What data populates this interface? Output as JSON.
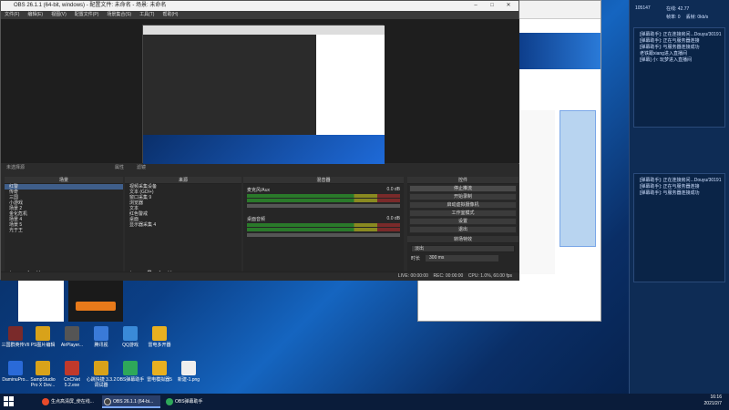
{
  "obs": {
    "title": "OBS 26.1.1 (64-bit, windows) - 配置文件: 未命名 - 场景: 未命名",
    "menu": [
      "文件(F)",
      "编辑(E)",
      "视图(V)",
      "配置文件(P)",
      "场景集合(S)",
      "工具(T)",
      "帮助(H)"
    ],
    "no_source_selected": "未选择源",
    "properties_label": "属性",
    "filters_label": "滤镜",
    "docks": {
      "scenes_title": "场景",
      "scenes": [
        "红警",
        "传奇",
        "三国",
        "小游戏",
        "场景 2",
        "金化危机",
        "场景 4",
        "场景 5",
        "光于王"
      ],
      "sources_title": "来源",
      "sources": [
        "视频采集设备",
        "文本 (GDI+)",
        "窗口采集 9",
        "浏览器",
        "文本",
        "红色警戒",
        "桌面",
        "显示器采集 4"
      ],
      "mixer_title": "混音器",
      "mixer": [
        {
          "name": "麦克风/Aux",
          "db": "0.0 dB"
        },
        {
          "name": "桌面音频",
          "db": "0.0 dB"
        }
      ],
      "controls_title": "控件",
      "controls": [
        "停止推流",
        "开始录制",
        "启动虚拟摄像机",
        "工作室模式",
        "设置",
        "退出"
      ],
      "transitions_title": "转场特效",
      "transition_type": "淡出",
      "duration_label": "时长",
      "duration_value": "300 ms"
    },
    "status": {
      "live": "LIVE: 00:00:00",
      "rec": "REC: 00:00:00",
      "cpu": "CPU: 1.0%, 60.00 fps"
    }
  },
  "rpanel": {
    "stats": [
      "在线: 42.77",
      "帧率: 0",
      "丢帧: 0kb/s"
    ],
    "user_id": "105147",
    "messages": [
      "[弹幕助手]: 正在连接房间...Douyu/30191",
      "[弹幕助手]: 正在与服务器连接",
      "[弹幕助手]: 与服务器连接成功",
      "老铁跟xiang进入直播间",
      "[弹幕] 小: 玩梦进入直播间"
    ],
    "messages2": [
      "[弹幕助手]: 正在连接房间...Douyu/30191",
      "[弹幕助手]: 正在与服务器连接",
      "[弹幕助手]: 与服务器连接成功"
    ]
  },
  "desktop_icons": [
    {
      "label": "三国群英传VII",
      "color": "#7a2a2a"
    },
    {
      "label": "PS图片编辑",
      "color": "#d8a21a"
    },
    {
      "label": "AirPlayer...",
      "color": "#555"
    },
    {
      "label": "腾讯视",
      "color": "#3a7ad8"
    },
    {
      "label": "QQ游戏",
      "color": "#3a8ad8"
    },
    {
      "label": "雷电多开器",
      "color": "#e8b020"
    },
    {
      "label": "DaminuPro...",
      "color": "#2a6ad8"
    },
    {
      "label": "SampStudio Pro X Dev...",
      "color": "#d8a21a"
    },
    {
      "label": "CnCNet 5.2.exe",
      "color": "#c0392b"
    },
    {
      "label": "心跳快捷 3.3.2 调试器",
      "color": "#d8a21a"
    },
    {
      "label": "OBS弹幕助手",
      "color": "#2ea85a"
    },
    {
      "label": "雷电模拟器5",
      "color": "#e8b020"
    },
    {
      "label": "新建-1.png",
      "color": "#eee"
    }
  ],
  "taskbar": {
    "items": [
      "生点高清屏_使在线...",
      "OBS 26.1.1 (64-bi...",
      "OBS弹幕助手"
    ],
    "time": "16:16",
    "date": "2021/2/7"
  },
  "colors": {
    "accent": "#3f5e8a",
    "live": "#2a7a2a"
  }
}
